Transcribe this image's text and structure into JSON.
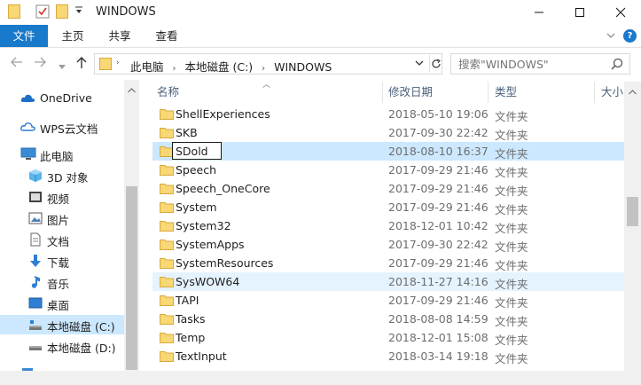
{
  "window": {
    "title": "WINDOWS",
    "controls": [
      "minimize",
      "maximize",
      "close"
    ]
  },
  "ribbon": {
    "tabs": [
      "文件",
      "主页",
      "共享",
      "查看"
    ]
  },
  "address": {
    "crumbs": [
      "此电脑",
      "本地磁盘 (C:)",
      "WINDOWS"
    ]
  },
  "search": {
    "placeholder": "搜索\"WINDOWS\""
  },
  "nav": {
    "items": [
      {
        "label": "OneDrive",
        "icon": "cloud-icon",
        "selected": false
      },
      {
        "label": "WPS云文档",
        "icon": "cloud-icon",
        "selected": false
      },
      {
        "label": "此电脑",
        "icon": "computer-icon",
        "selected": false
      },
      {
        "label": "3D 对象",
        "icon": "cube-icon",
        "selected": false
      },
      {
        "label": "视频",
        "icon": "video-icon",
        "selected": false
      },
      {
        "label": "图片",
        "icon": "picture-icon",
        "selected": false
      },
      {
        "label": "文档",
        "icon": "document-icon",
        "selected": false
      },
      {
        "label": "下载",
        "icon": "download-icon",
        "selected": false
      },
      {
        "label": "音乐",
        "icon": "music-icon",
        "selected": false
      },
      {
        "label": "桌面",
        "icon": "desktop-icon",
        "selected": false
      },
      {
        "label": "本地磁盘 (C:)",
        "icon": "drive-icon",
        "selected": true
      },
      {
        "label": "本地磁盘 (D:)",
        "icon": "drive-icon",
        "selected": false
      }
    ]
  },
  "columns": {
    "name": "名称",
    "date": "修改日期",
    "type": "类型",
    "size": "大小"
  },
  "files": [
    {
      "name": "ShellExperiences",
      "date": "2018-05-10 19:06",
      "type": "文件夹"
    },
    {
      "name": "SKB",
      "date": "2017-09-30 22:42",
      "type": "文件夹"
    },
    {
      "name": "SDold",
      "date": "2018-08-10 16:37",
      "type": "文件夹"
    },
    {
      "name": "Speech",
      "date": "2017-09-29 21:46",
      "type": "文件夹"
    },
    {
      "name": "Speech_OneCore",
      "date": "2017-09-29 21:46",
      "type": "文件夹"
    },
    {
      "name": "System",
      "date": "2017-09-29 21:46",
      "type": "文件夹"
    },
    {
      "name": "System32",
      "date": "2018-12-01 10:42",
      "type": "文件夹"
    },
    {
      "name": "SystemApps",
      "date": "2017-09-30 22:42",
      "type": "文件夹"
    },
    {
      "name": "SystemResources",
      "date": "2017-09-29 21:46",
      "type": "文件夹"
    },
    {
      "name": "SysWOW64",
      "date": "2018-11-27 14:16",
      "type": "文件夹"
    },
    {
      "name": "TAPI",
      "date": "2017-09-29 21:46",
      "type": "文件夹"
    },
    {
      "name": "Tasks",
      "date": "2018-08-08 14:59",
      "type": "文件夹"
    },
    {
      "name": "Temp",
      "date": "2018-12-01 15:08",
      "type": "文件夹"
    },
    {
      "name": "TextInput",
      "date": "2018-03-14 19:18",
      "type": "文件夹"
    }
  ],
  "selected_row": 2,
  "renaming_row": 2,
  "hover_row": 9,
  "colors": {
    "accent": "#1979ca",
    "selection": "#cce8ff",
    "hover": "#e5f3ff",
    "folder": "#f8d775"
  }
}
